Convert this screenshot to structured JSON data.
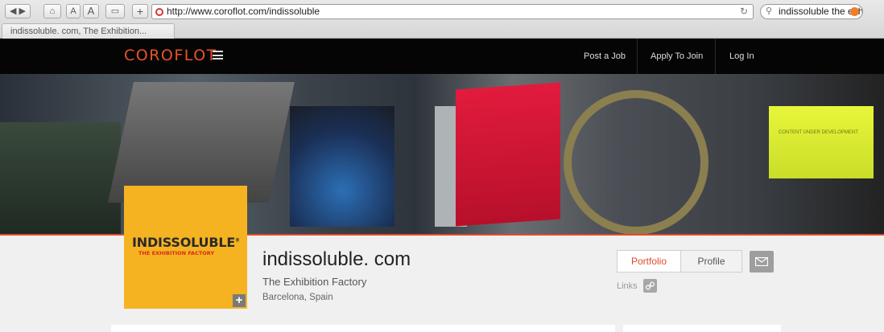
{
  "browser": {
    "url": "http://www.coroflot.com/indissoluble",
    "search_value": "indissoluble the exhi",
    "tab_title": "indissoluble. com, The Exhibition...",
    "text_size_small": "A",
    "text_size_large": "A"
  },
  "site": {
    "logo": "COROFLOT",
    "nav": [
      "Post a Job",
      "Apply To Join",
      "Log In"
    ]
  },
  "banner": {
    "screen_text": "CONTENT UNDER DEVELOPMENT"
  },
  "profile": {
    "avatar_brand": "INDISSOLUBLE",
    "avatar_tagline": "THE EXHIBITION FACTORY",
    "name": "indissoluble. com",
    "subtitle": "The Exhibition Factory",
    "location": "Barcelona, Spain",
    "tabs": {
      "portfolio": "Portfolio",
      "profile": "Profile"
    },
    "links_label": "Links"
  },
  "colors": {
    "accent": "#e04b2a",
    "avatar_bg": "#f5b321",
    "header_bg": "#050505"
  }
}
